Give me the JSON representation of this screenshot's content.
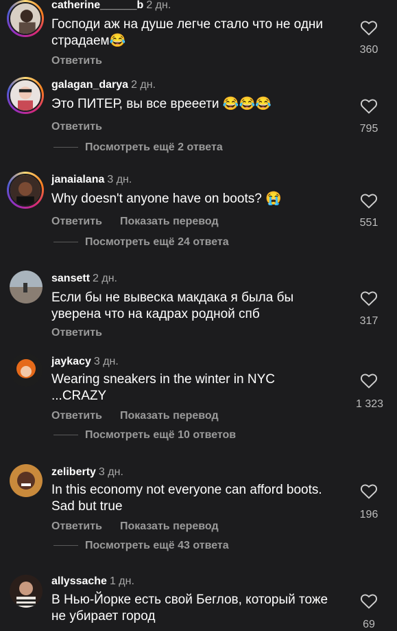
{
  "comments": [
    {
      "username": "catherine______b",
      "time": "2 дн.",
      "text": "Господи аж на душе легче стало что не одни страдаем😂",
      "reply_label": "Ответить",
      "likes": "360"
    },
    {
      "username": "galagan_darya",
      "time": "2 дн.",
      "text": "Это ПИТЕР, вы все врееети 😂😂😂",
      "reply_label": "Ответить",
      "likes": "795",
      "view_replies": "Посмотреть ещё 2 ответа"
    },
    {
      "username": "janaialana",
      "time": "3 дн.",
      "text": "Why doesn't anyone have on boots? 😭",
      "reply_label": "Ответить",
      "translate_label": "Показать перевод",
      "likes": "551",
      "view_replies": "Посмотреть ещё 24 ответа"
    },
    {
      "username": "sansett",
      "time": "2 дн.",
      "text": "Если бы не вывеска макдака я была бы уверена что на кадрах родной спб",
      "reply_label": "Ответить",
      "likes": "317"
    },
    {
      "username": "jaykacy",
      "time": "3 дн.",
      "text": "Wearing sneakers in the winter in NYC ...CRAZY",
      "reply_label": "Ответить",
      "translate_label": "Показать перевод",
      "likes": "1 323",
      "view_replies": "Посмотреть ещё 10 ответов"
    },
    {
      "username": "zeliberty",
      "time": "3 дн.",
      "text": "In this economy not everyone can afford boots. Sad but true",
      "reply_label": "Ответить",
      "translate_label": "Показать перевод",
      "likes": "196",
      "view_replies": "Посмотреть ещё 43 ответа"
    },
    {
      "username": "allyssache",
      "time": "1 дн.",
      "text": "В Нью-Йорке есть свой Беглов, который тоже не убирает город",
      "likes": "69"
    }
  ],
  "icons": {
    "like": "heart-outline-icon"
  },
  "colors": {
    "background": "#1c1c1e",
    "secondary_text": "#9a9a9a",
    "story_ring_start": "#feda75",
    "story_ring_end": "#962fbf"
  }
}
